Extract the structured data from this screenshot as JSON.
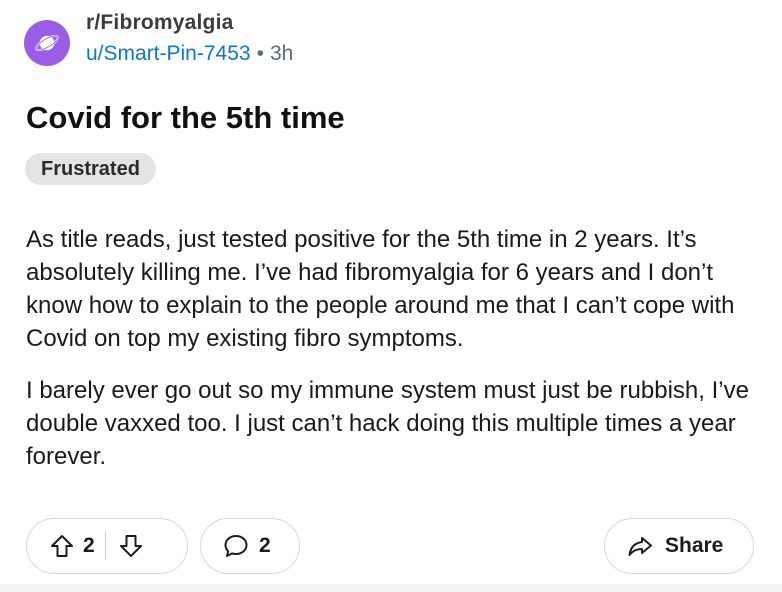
{
  "post": {
    "subreddit": "r/Fibromyalgia",
    "author": "u/Smart-Pin-7453",
    "separator": "•",
    "age": "3h",
    "title": "Covid for the 5th time",
    "flair": "Frustrated",
    "paragraphs": [
      "As title reads, just tested positive for the 5th time in 2 years. It’s absolutely killing me. I’ve had fibromyalgia for 6 years and I don’t know how to explain to the people around me that I can’t cope with Covid on top my existing fibro symptoms.",
      "I barely ever go out so my immune system must just be rubbish, I’ve double vaxxed too. I just can’t hack doing this multiple times a year forever."
    ]
  },
  "actions": {
    "upvote_count": "2",
    "comment_count": "2",
    "share_label": "Share"
  },
  "icons": {
    "avatar": "planet-icon",
    "upvote": "arrow-up-icon",
    "downvote": "arrow-down-icon",
    "comment": "speech-bubble-icon",
    "share": "share-arrow-icon"
  },
  "colors": {
    "avatar_bg": "#9b5de5",
    "username": "#0b78c9",
    "flair_bg": "#e4e4e4"
  }
}
